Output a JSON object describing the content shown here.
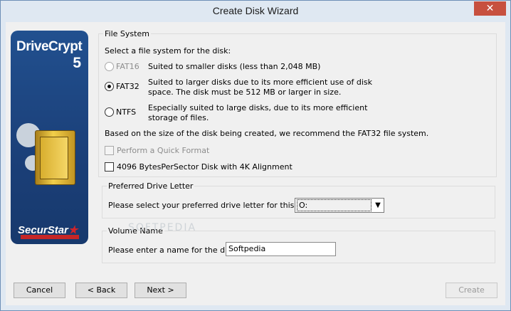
{
  "window": {
    "title": "Create Disk Wizard",
    "close_glyph": "✕"
  },
  "logo": {
    "product_name": "DriveCrypt",
    "product_version": "5",
    "brand": "SecurStar"
  },
  "file_system": {
    "legend": "File System",
    "prompt": "Select a file system for the disk:",
    "options": [
      {
        "label": "FAT16",
        "desc_lines": [
          "Suited to smaller disks (less than 2,048 MB)"
        ],
        "selected": false,
        "enabled": false
      },
      {
        "label": "FAT32",
        "desc_lines": [
          "Suited to larger disks due to its more efficient use of disk",
          "space. The disk must be 512 MB or larger in size."
        ],
        "selected": true,
        "enabled": true
      },
      {
        "label": "NTFS",
        "desc_lines": [
          "Especially suited to large disks, due to its more efficient",
          "storage of files."
        ],
        "selected": false,
        "enabled": true
      }
    ],
    "recommendation": "Based on the size of the disk being created, we recommend the FAT32 file system.",
    "quick_format": {
      "label": "Perform a Quick Format",
      "checked": false,
      "enabled": false
    },
    "alignment": {
      "label": "4096 BytesPerSector Disk with 4K Alignment",
      "checked": false,
      "enabled": true
    }
  },
  "drive_letter": {
    "legend": "Preferred Drive Letter",
    "prompt": "Please select your preferred drive letter for this disk",
    "selected": "O:"
  },
  "volume_name": {
    "legend": "Volume Name",
    "prompt": "Please enter a name for the disk",
    "value": "Softpedia"
  },
  "watermark": "SOFTPEDIA",
  "buttons": {
    "cancel": "Cancel",
    "back": "< Back",
    "next": "Next >",
    "create": "Create"
  }
}
